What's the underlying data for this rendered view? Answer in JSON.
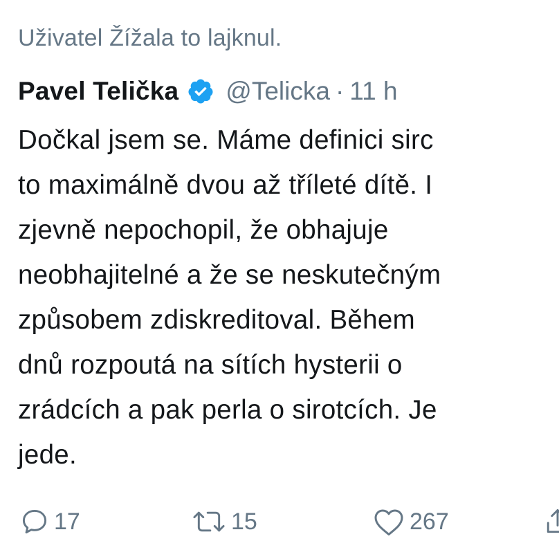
{
  "social_context": {
    "text": "Uživatel Žížala to lajknul."
  },
  "author": {
    "display_name": "Pavel Telička",
    "handle": "@Telicka",
    "separator": "·",
    "time": "11 h",
    "verified_icon": "verified-badge-icon",
    "verified_color": "#1da1f2"
  },
  "tweet": {
    "lines": [
      "Dočkal jsem se. Máme definici sirc",
      "to maximálně dvou až tříleté dítě. I",
      "zjevně nepochopil, že obhajuje",
      "neobhajitelné a že se neskutečným",
      "způsobem zdiskreditoval. Během",
      "dnů rozpoutá na sítích hysterii o",
      "zrádcích a pak perla o sirotcích. Je",
      "jede."
    ]
  },
  "actions": {
    "reply": {
      "icon": "reply-icon",
      "count": "17"
    },
    "retweet": {
      "icon": "retweet-icon",
      "count": "15"
    },
    "like": {
      "icon": "heart-icon",
      "count": "267"
    },
    "share": {
      "icon": "share-icon"
    }
  },
  "colors": {
    "text": "#14171a",
    "secondary": "#657786",
    "accent": "#1da1f2"
  }
}
